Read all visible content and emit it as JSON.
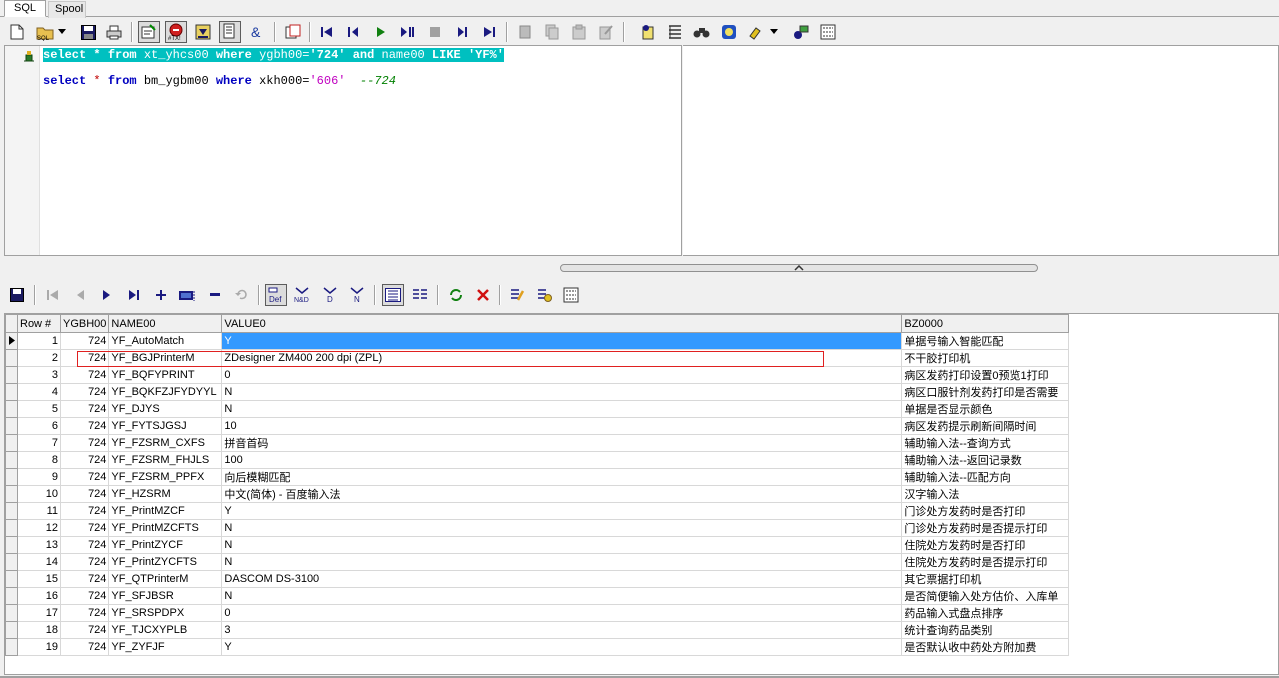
{
  "tabs": [
    {
      "label": "SQL",
      "active": true
    },
    {
      "label": "Spool",
      "active": false
    }
  ],
  "sql_lines": [
    {
      "selected": true,
      "tokens": [
        [
          "kw",
          "select"
        ],
        [
          "t",
          " "
        ],
        [
          "op",
          "*"
        ],
        [
          "t",
          " "
        ],
        [
          "kw",
          "from"
        ],
        [
          "t",
          " xt_yhcs00 "
        ],
        [
          "kw",
          "where"
        ],
        [
          "t",
          " ygbh00="
        ],
        [
          "str",
          "'724'"
        ],
        [
          "t",
          " "
        ],
        [
          "kw",
          "and"
        ],
        [
          "t",
          " name00 "
        ],
        [
          "kw",
          "LIKE"
        ],
        [
          "t",
          " "
        ],
        [
          "str",
          "'YF%'"
        ]
      ]
    },
    {
      "selected": false,
      "tokens": [
        [
          "kw",
          "select"
        ],
        [
          "t",
          " "
        ],
        [
          "op",
          "*"
        ],
        [
          "t",
          " "
        ],
        [
          "kw",
          "from"
        ],
        [
          "t",
          " bm_ygbm00 "
        ],
        [
          "kw",
          "where"
        ],
        [
          "t",
          " xkh000="
        ],
        [
          "str",
          "'606'"
        ],
        [
          "t",
          "  "
        ],
        [
          "cmt",
          "--724"
        ]
      ]
    }
  ],
  "grid": {
    "columns": [
      "Row #",
      "YGBH00",
      "NAME00",
      "VALUE0",
      "BZ0000"
    ],
    "rows": [
      [
        "1",
        "724",
        "YF_AutoMatch",
        "Y",
        "单据号输入智能匹配"
      ],
      [
        "2",
        "724",
        "YF_BGJPrinterM",
        "ZDesigner ZM400 200 dpi (ZPL)",
        "不干胶打印机"
      ],
      [
        "3",
        "724",
        "YF_BQFYPRINT",
        "0",
        "病区发药打印设置0预览1打印"
      ],
      [
        "4",
        "724",
        "YF_BQKFZJFYDYYL",
        "N",
        "病区口服针剂发药打印是否需要"
      ],
      [
        "5",
        "724",
        "YF_DJYS",
        "N",
        "单据是否显示颜色"
      ],
      [
        "6",
        "724",
        "YF_FYTSJGSJ",
        "10",
        "病区发药提示刷新间隔时间"
      ],
      [
        "7",
        "724",
        "YF_FZSRM_CXFS",
        "拼音首码",
        "辅助输入法--查询方式"
      ],
      [
        "8",
        "724",
        "YF_FZSRM_FHJLS",
        "100",
        "辅助输入法--返回记录数"
      ],
      [
        "9",
        "724",
        "YF_FZSRM_PPFX",
        "向后模糊匹配",
        "辅助输入法--匹配方向"
      ],
      [
        "10",
        "724",
        "YF_HZSRM",
        "中文(简体) - 百度输入法",
        "汉字输入法"
      ],
      [
        "11",
        "724",
        "YF_PrintMZCF",
        "Y",
        "门诊处方发药时是否打印"
      ],
      [
        "12",
        "724",
        "YF_PrintMZCFTS",
        "N",
        "门诊处方发药时是否提示打印"
      ],
      [
        "13",
        "724",
        "YF_PrintZYCF",
        "N",
        "住院处方发药时是否打印"
      ],
      [
        "14",
        "724",
        "YF_PrintZYCFTS",
        "N",
        "住院处方发药时是否提示打印"
      ],
      [
        "15",
        "724",
        "YF_QTPrinterM",
        "DASCOM DS-3100",
        "其它票据打印机"
      ],
      [
        "16",
        "724",
        "YF_SFJBSR",
        "N",
        "是否简便输入处方估价、入库单"
      ],
      [
        "17",
        "724",
        "YF_SRSPDPX",
        "0",
        "药品输入式盘点排序"
      ],
      [
        "18",
        "724",
        "YF_TJCXYPLB",
        "3",
        "统计查询药品类别"
      ],
      [
        "19",
        "724",
        "YF_ZYFJF",
        "Y",
        "是否默认收中药处方附加费"
      ]
    ]
  }
}
